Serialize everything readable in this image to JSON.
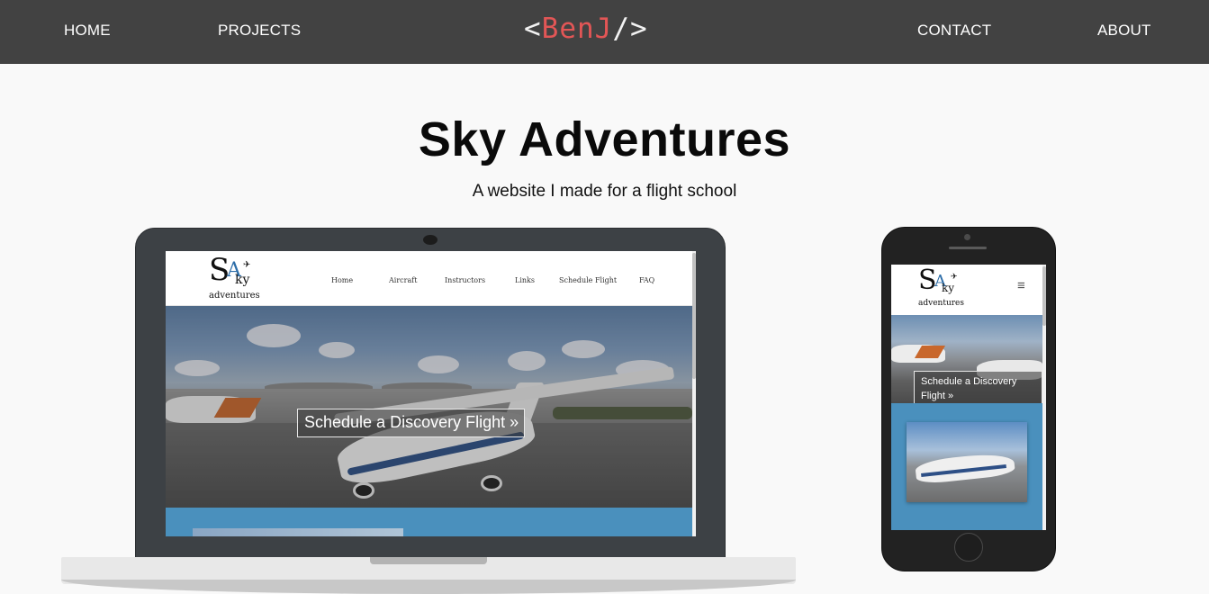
{
  "nav": {
    "home": "HOME",
    "projects": "PROJECTS",
    "contact": "CONTACT",
    "about": "ABOUT",
    "logo_open": "<",
    "logo_name": "BenJ",
    "logo_close": "/>"
  },
  "header": {
    "title": "Sky Adventures",
    "subtitle": "A website I made for a flight school"
  },
  "laptop_site": {
    "logo_s": "S",
    "logo_a": "A",
    "logo_ky": "ky",
    "logo_adventures": "adventures",
    "nav": {
      "home": "Home",
      "aircraft": "Aircraft",
      "instructors": "Instructors",
      "links": "Links",
      "schedule": "Schedule Flight",
      "faq": "FAQ"
    },
    "cta": "Schedule a Discovery Flight »"
  },
  "phone_site": {
    "logo_s": "S",
    "logo_a": "A",
    "logo_ky": "ky",
    "logo_adventures": "adventures",
    "menu_icon": "≡",
    "cta": "Schedule a Discovery Flight »"
  },
  "colors": {
    "navbar": "#424242",
    "logo_accent": "#e25656",
    "site_band": "#4a90bd"
  }
}
